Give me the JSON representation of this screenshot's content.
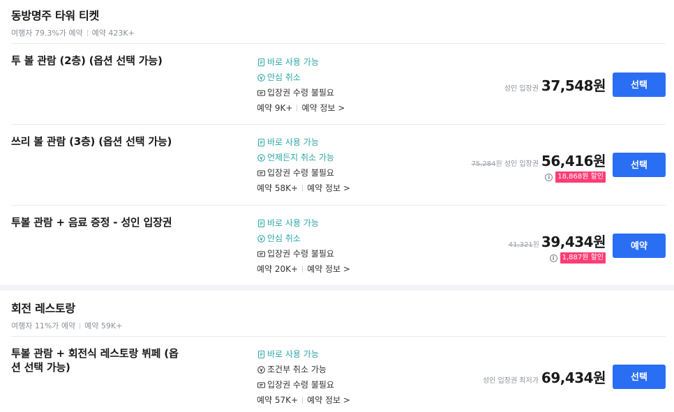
{
  "sections": [
    {
      "title": "동방명주 타워 티켓",
      "traveler": "여행자 79.3%가 예약",
      "bookings": "예약 423K+",
      "items": [
        {
          "title": "투 볼 관람 (2층) (옵션 선택 가능)",
          "f1": "바로 사용 가능",
          "f2": "안심 취소",
          "f3": "입장권 수령 불필요",
          "booked": "예약 9K+",
          "info": "예약 정보 >",
          "label": "성인 입장권",
          "price": "37,548원",
          "button": "선택"
        },
        {
          "title": "쓰리 볼 관람 (3층) (옵션 선택 가능)",
          "f1": "바로 사용 가능",
          "f2": "언제든지 취소 가능",
          "f3": "입장권 수령 불필요",
          "booked": "예약 58K+",
          "info": "예약 정보 >",
          "original": "75,284",
          "won": "원",
          "label": "성인 입장권",
          "price": "56,416원",
          "discount": "18,868원 할인",
          "button": "선택"
        },
        {
          "title": "투볼 관람 + 음료 증정 - 성인 입장권",
          "f1": "바로 사용 가능",
          "f2": "안심 취소",
          "f3": "입장권 수령 불필요",
          "booked": "예약 20K+",
          "info": "예약 정보 >",
          "original": "41,321",
          "won": "원",
          "price": "39,434원",
          "discount": "1,887원 할인",
          "button": "예약"
        }
      ]
    },
    {
      "title": "회전 레스토랑",
      "traveler": "여행자 11%가 예약",
      "bookings": "예약 59K+",
      "items": [
        {
          "title": "투볼 관람 + 회전식 레스토랑 뷔페 (옵션 선택 가능)",
          "f1": "바로 사용 가능",
          "f2": "조건부 취소 가능",
          "f3": "입장권 수령 불필요",
          "booked": "예약 57K+",
          "info": "예약 정보 >",
          "label": "성인 입장권 최저가",
          "price": "69,434원",
          "button": "선택"
        }
      ]
    }
  ],
  "colors": {
    "accent": "#2a6ef4",
    "teal": "#2aa6a4",
    "discount": "#ff3d74"
  }
}
